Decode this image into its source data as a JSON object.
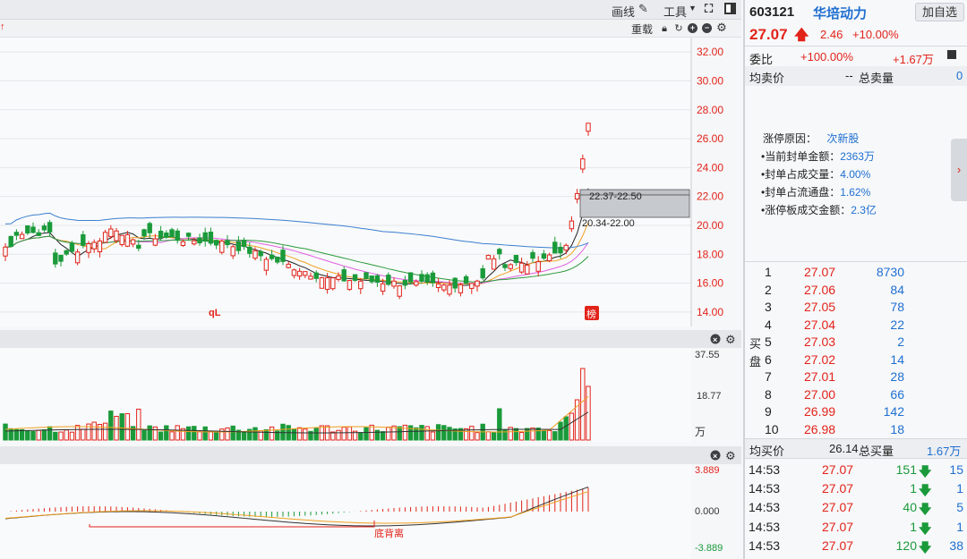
{
  "toolbar": {
    "draw_label": "画线",
    "tools_label": "工具",
    "reset_label": "重载"
  },
  "chart": {
    "price_axis": [
      "32.00",
      "30.00",
      "28.00",
      "26.00",
      "24.00",
      "22.00",
      "20.00",
      "18.00",
      "16.00",
      "14.00"
    ],
    "price_range": [
      13.0,
      33.0
    ],
    "zone1": "22.37-22.50",
    "zone2": "20.34-22.00",
    "marker_q": "qL",
    "marker_bang": "榜",
    "vol_axis": [
      "37.55",
      "18.77",
      "万"
    ],
    "macd_axis": [
      "3.889",
      "0.000",
      "-3.889"
    ],
    "macd_note": "底背离"
  },
  "stock": {
    "code": "603121",
    "name": "华培动力",
    "price": "27.07",
    "change": "2.46",
    "pct": "+10.00%",
    "add_label": "加自选"
  },
  "quote": {
    "wei_label": "委比",
    "wei_pct": "+100.00%",
    "wei_val": "+1.67万",
    "avg_sell_label": "均卖价",
    "avg_sell": "--",
    "total_sell_label": "总卖量",
    "total_sell": "0",
    "avg_buy_label": "均买价",
    "avg_buy": "26.14",
    "total_buy_label": "总买量",
    "total_buy": "1.67万",
    "buy_side_label": [
      "买",
      "盘"
    ]
  },
  "limit_info": {
    "reason_label": "涨停原因：",
    "reason": "次新股",
    "rows": [
      {
        "label": "当前封单金额：",
        "value": "2363万"
      },
      {
        "label": "封单占成交量：",
        "value": "4.00%"
      },
      {
        "label": "封单占流通盘：",
        "value": "1.62%"
      },
      {
        "label": "涨停板成交金额：",
        "value": "2.3亿"
      }
    ]
  },
  "bids": [
    {
      "level": "1",
      "price": "27.07",
      "vol": "8730"
    },
    {
      "level": "2",
      "price": "27.06",
      "vol": "84"
    },
    {
      "level": "3",
      "price": "27.05",
      "vol": "78"
    },
    {
      "level": "4",
      "price": "27.04",
      "vol": "22"
    },
    {
      "level": "5",
      "price": "27.03",
      "vol": "2"
    },
    {
      "level": "6",
      "price": "27.02",
      "vol": "14"
    },
    {
      "level": "7",
      "price": "27.01",
      "vol": "28"
    },
    {
      "level": "8",
      "price": "27.00",
      "vol": "66"
    },
    {
      "level": "9",
      "price": "26.99",
      "vol": "142"
    },
    {
      "level": "10",
      "price": "26.98",
      "vol": "18"
    }
  ],
  "trades": [
    {
      "time": "14:53",
      "price": "27.07",
      "vol": "151",
      "n": "15"
    },
    {
      "time": "14:53",
      "price": "27.07",
      "vol": "1",
      "n": "1"
    },
    {
      "time": "14:53",
      "price": "27.07",
      "vol": "40",
      "n": "5"
    },
    {
      "time": "14:53",
      "price": "27.07",
      "vol": "1",
      "n": "1"
    },
    {
      "time": "14:53",
      "price": "27.07",
      "vol": "120",
      "n": "38"
    }
  ],
  "colors": {
    "up": "#e2231a",
    "down": "#1a9a3a",
    "ma5": "#222222",
    "ma10": "#f0a020",
    "ma20": "#e060e0",
    "ma30": "#2a9a3a",
    "ma60": "#3a7fd0"
  }
}
